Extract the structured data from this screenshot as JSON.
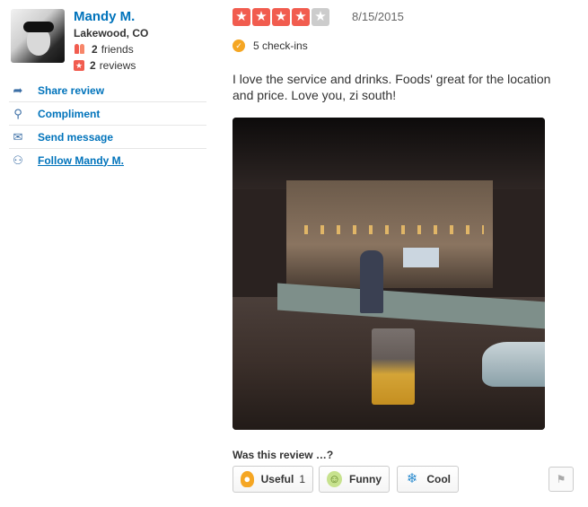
{
  "user": {
    "name": "Mandy M.",
    "location": "Lakewood, CO",
    "friends_count": "2",
    "friends_label": "friends",
    "reviews_count": "2",
    "reviews_label": "reviews"
  },
  "actions": [
    {
      "label": "Share review",
      "icon": "share-arrow-icon"
    },
    {
      "label": "Compliment",
      "icon": "award-ribbon-icon"
    },
    {
      "label": "Send message",
      "icon": "envelope-icon"
    },
    {
      "label": "Follow Mandy M.",
      "icon": "follow-user-icon"
    }
  ],
  "review": {
    "rating": 4,
    "max_rating": 5,
    "date": "8/15/2015",
    "checkins": "5 check-ins",
    "text": "I love the service and drinks.  Foods' great for the location and price.  Love you, zi south!"
  },
  "feedback": {
    "title": "Was this review …?",
    "useful_label": "Useful",
    "useful_count": "1",
    "funny_label": "Funny",
    "cool_label": "Cool"
  },
  "colors": {
    "accent_link": "#0073bb",
    "star_on": "#f15c4f",
    "star_off": "#cccccc",
    "checkin_badge": "#f5a623"
  }
}
